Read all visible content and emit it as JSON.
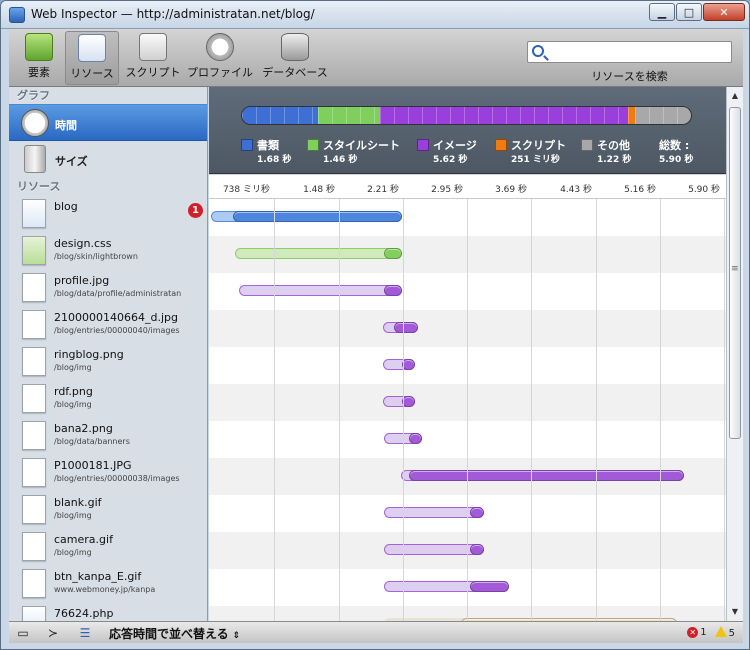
{
  "window": {
    "title": "Web Inspector — http://administratan.net/blog/",
    "minimize": "▁",
    "maximize": "□",
    "close": "✕"
  },
  "toolbar": {
    "items": [
      {
        "label": "要素",
        "icon": "elements-icon"
      },
      {
        "label": "リソース",
        "icon": "resources-icon"
      },
      {
        "label": "スクリプト",
        "icon": "scripts-icon"
      },
      {
        "label": "プロファイル",
        "icon": "profiles-icon"
      },
      {
        "label": "データベース",
        "icon": "databases-icon"
      }
    ],
    "active_index": 1,
    "search_label": "リソースを検索",
    "search_value": ""
  },
  "sidebar": {
    "graph_heading": "グラフ",
    "graphs": [
      {
        "label": "時間",
        "icon": "clock-icon",
        "selected": true
      },
      {
        "label": "サイズ",
        "icon": "size-icon",
        "selected": false
      }
    ],
    "resources_heading": "リソース",
    "resources": [
      {
        "name": "blog",
        "path": "",
        "icon": "document-icon",
        "errors": "1",
        "type": "document",
        "start": 0.0,
        "response": 0.25,
        "end": 2.21
      },
      {
        "name": "design.css",
        "path": "/blog/skin/lightbrown",
        "icon": "css-icon",
        "errors": "",
        "type": "stylesheet",
        "start": 0.28,
        "response": 2.0,
        "end": 2.21
      },
      {
        "name": "profile.jpg",
        "path": "/blog/data/profile/administratan",
        "icon": "image-icon",
        "errors": "",
        "type": "image",
        "start": 0.33,
        "response": 2.0,
        "end": 2.21
      },
      {
        "name": "2100000140664_d.jpg",
        "path": "/blog/entries/00000040/images",
        "icon": "image-icon",
        "errors": "",
        "type": "image",
        "start": 1.99,
        "response": 2.12,
        "end": 2.4
      },
      {
        "name": "ringblog.png",
        "path": "/blog/img",
        "icon": "image-icon",
        "errors": "",
        "type": "image",
        "start": 1.99,
        "response": 2.21,
        "end": 2.37
      },
      {
        "name": "rdf.png",
        "path": "/blog/img",
        "icon": "image-icon",
        "errors": "",
        "type": "image",
        "start": 1.99,
        "response": 2.21,
        "end": 2.37
      },
      {
        "name": "bana2.png",
        "path": "/blog/data/banners",
        "icon": "image-icon",
        "errors": "",
        "type": "image",
        "start": 2.0,
        "response": 2.3,
        "end": 2.45
      },
      {
        "name": "P1000181.JPG",
        "path": "/blog/entries/00000038/images",
        "icon": "image-icon",
        "errors": "",
        "type": "image",
        "start": 2.2,
        "response": 2.3,
        "end": 5.48
      },
      {
        "name": "blank.gif",
        "path": "/blog/img",
        "icon": "image-icon",
        "errors": "",
        "type": "image",
        "start": 2.0,
        "response": 3.0,
        "end": 3.17
      },
      {
        "name": "camera.gif",
        "path": "/blog/img",
        "icon": "camera-icon",
        "errors": "",
        "type": "image",
        "start": 2.0,
        "response": 3.0,
        "end": 3.17
      },
      {
        "name": "btn_kanpa_E.gif",
        "path": "www.webmoney.jp/kanpa",
        "icon": "image-icon",
        "errors": "",
        "type": "image",
        "start": 2.0,
        "response": 3.0,
        "end": 3.45
      },
      {
        "name": "76624.php",
        "path": "",
        "icon": "document-icon",
        "errors": "",
        "type": "other",
        "start": 2.0,
        "response": 2.9,
        "end": 5.4
      }
    ]
  },
  "summary": {
    "legend": [
      {
        "name": "書類",
        "value": "1.68 秒",
        "color": "#3d6fd4"
      },
      {
        "name": "スタイルシート",
        "value": "1.46 秒",
        "color": "#7fcf5e"
      },
      {
        "name": "イメージ",
        "value": "5.62 秒",
        "color": "#9b3fdc"
      },
      {
        "name": "スクリプト",
        "value": "251 ミリ秒",
        "color": "#f07b10"
      },
      {
        "name": "その他",
        "value": "1.22 秒",
        "color": "#a8a8a8"
      }
    ],
    "total_label": "総数 :",
    "total_value": "5.90 秒"
  },
  "timeline": {
    "ticks": [
      "738 ミリ秒",
      "1.48 秒",
      "2.21 秒",
      "2.95 秒",
      "3.69 秒",
      "4.43 秒",
      "5.16 秒",
      "5.90 秒"
    ],
    "max": 5.9
  },
  "statusbar": {
    "sort_label": "応答時間で並べ替える",
    "error_count": "1",
    "warning_count": "5"
  }
}
